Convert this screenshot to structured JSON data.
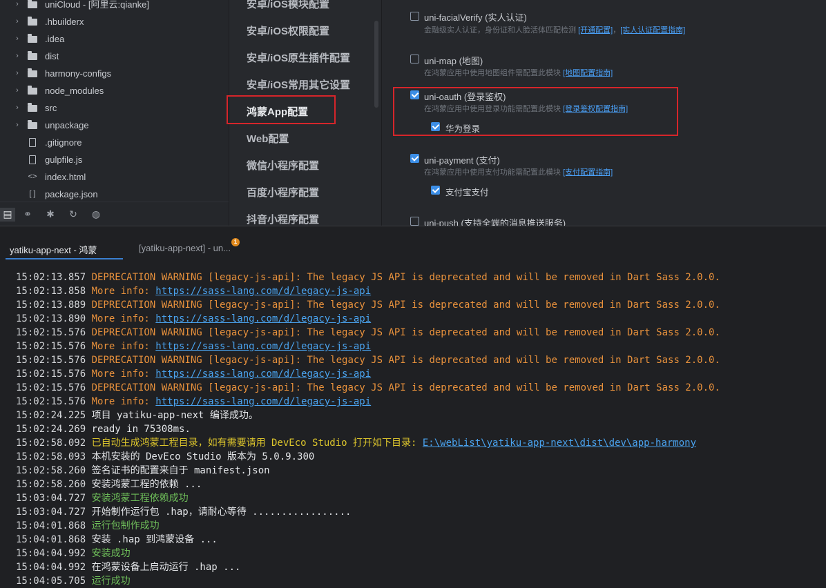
{
  "explorer": {
    "items": [
      {
        "label": "uniCloud - [阿里云:qianke]",
        "type": "folder",
        "expandable": true
      },
      {
        "label": ".hbuilderx",
        "type": "folder",
        "expandable": true
      },
      {
        "label": ".idea",
        "type": "folder",
        "expandable": true
      },
      {
        "label": "dist",
        "type": "folder",
        "expandable": true
      },
      {
        "label": "harmony-configs",
        "type": "folder",
        "expandable": true
      },
      {
        "label": "node_modules",
        "type": "folder",
        "expandable": true
      },
      {
        "label": "src",
        "type": "folder",
        "expandable": true
      },
      {
        "label": "unpackage",
        "type": "folder",
        "expandable": true
      },
      {
        "label": ".gitignore",
        "type": "file-icon",
        "expandable": false
      },
      {
        "label": "gulpfile.js",
        "type": "js-file-icon",
        "expandable": false
      },
      {
        "label": "index.html",
        "type": "html-file-icon",
        "expandable": false
      },
      {
        "label": "package.json",
        "type": "json-file-icon",
        "expandable": false
      }
    ],
    "bottom_icons": [
      "project-manager-icon",
      "binoculars-icon",
      "bug-icon",
      "git-refresh-icon",
      "globe-icon"
    ]
  },
  "settings_nav": {
    "items": [
      {
        "label": "安卓/iOS模块配置"
      },
      {
        "label": "安卓/iOS权限配置"
      },
      {
        "label": "安卓/iOS原生插件配置"
      },
      {
        "label": "安卓/iOS常用其它设置"
      },
      {
        "label": "鸿蒙App配置",
        "selected": true
      },
      {
        "label": "Web配置"
      },
      {
        "label": "微信小程序配置"
      },
      {
        "label": "百度小程序配置"
      },
      {
        "label": "抖音小程序配置"
      }
    ]
  },
  "modules": {
    "facial": {
      "checked": false,
      "title": "uni-facialVerify (实人认证)",
      "desc": "金融级实人认证，身份证和人脸活体匹配检测",
      "link1": "[开通配置]",
      "sep": "，",
      "link2": "[实人认证配置指南]"
    },
    "map": {
      "checked": false,
      "title": "uni-map (地图)",
      "desc": "在鸿蒙应用中使用地图组件需配置此模块",
      "link": "[地图配置指南]"
    },
    "oauth": {
      "checked": true,
      "title": "uni-oauth (登录鉴权)",
      "desc": "在鸿蒙应用中使用登录功能需配置此模块",
      "link": "[登录鉴权配置指南]",
      "sub": {
        "checked": true,
        "label": "华为登录"
      }
    },
    "payment": {
      "checked": true,
      "title": "uni-payment (支付)",
      "desc": "在鸿蒙应用中使用支付功能需配置此模块",
      "link": "[支付配置指南]",
      "sub": {
        "checked": true,
        "label": "支付宝支付"
      }
    },
    "push": {
      "checked": false,
      "title": "uni-push (支持全端的消息推送服务)"
    }
  },
  "console": {
    "tabs": [
      {
        "label": "yatiku-app-next - 鸿蒙",
        "active": true
      },
      {
        "label": "[yatiku-app-next] - un...",
        "active": false,
        "badge": "1"
      }
    ],
    "lines": [
      {
        "ts": "15:02:13.857",
        "style": "warn",
        "text": "DEPRECATION WARNING [legacy-js-api]: The legacy JS API is deprecated and will be removed in Dart Sass 2.0.0."
      },
      {
        "ts": "15:02:13.858",
        "style": "warn",
        "text": "More info: ",
        "link": "https://sass-lang.com/d/legacy-js-api"
      },
      {
        "ts": "15:02:13.889",
        "style": "warn",
        "text": "DEPRECATION WARNING [legacy-js-api]: The legacy JS API is deprecated and will be removed in Dart Sass 2.0.0."
      },
      {
        "ts": "15:02:13.890",
        "style": "warn",
        "text": "More info: ",
        "link": "https://sass-lang.com/d/legacy-js-api"
      },
      {
        "ts": "15:02:15.576",
        "style": "warn",
        "text": "DEPRECATION WARNING [legacy-js-api]: The legacy JS API is deprecated and will be removed in Dart Sass 2.0.0."
      },
      {
        "ts": "15:02:15.576",
        "style": "warn",
        "text": "More info: ",
        "link": "https://sass-lang.com/d/legacy-js-api"
      },
      {
        "ts": "15:02:15.576",
        "style": "warn",
        "text": "DEPRECATION WARNING [legacy-js-api]: The legacy JS API is deprecated and will be removed in Dart Sass 2.0.0."
      },
      {
        "ts": "15:02:15.576",
        "style": "warn",
        "text": "More info: ",
        "link": "https://sass-lang.com/d/legacy-js-api"
      },
      {
        "ts": "15:02:15.576",
        "style": "warn",
        "text": "DEPRECATION WARNING [legacy-js-api]: The legacy JS API is deprecated and will be removed in Dart Sass 2.0.0."
      },
      {
        "ts": "15:02:15.576",
        "style": "warn",
        "text": "More info: ",
        "link": "https://sass-lang.com/d/legacy-js-api"
      },
      {
        "ts": "15:02:24.225",
        "style": "plain",
        "text": "项目 yatiku-app-next 编译成功。"
      },
      {
        "ts": "15:02:24.269",
        "style": "plain",
        "text": "ready in 75308ms."
      },
      {
        "ts": "15:02:58.092",
        "style": "yellow",
        "text": "已自动生成鸿蒙工程目录，如有需要请用 DevEco Studio 打开如下目录: ",
        "link": "E:\\webList\\yatiku-app-next\\dist\\dev\\app-harmony"
      },
      {
        "ts": "15:02:58.093",
        "style": "plain",
        "text": "本机安装的 DevEco Studio 版本为 5.0.9.300"
      },
      {
        "ts": "15:02:58.260",
        "style": "plain",
        "text": "签名证书的配置来自于 manifest.json"
      },
      {
        "ts": "15:02:58.260",
        "style": "plain",
        "text": "安装鸿蒙工程的依赖 ..."
      },
      {
        "ts": "15:03:04.727",
        "style": "ok",
        "text": "安装鸿蒙工程依赖成功"
      },
      {
        "ts": "15:03:04.727",
        "style": "plain",
        "text": "开始制作运行包 .hap，请耐心等待 ................."
      },
      {
        "ts": "15:04:01.868",
        "style": "ok",
        "text": "运行包制作成功"
      },
      {
        "ts": "15:04:01.868",
        "style": "plain",
        "text": "安装 .hap 到鸿蒙设备 ..."
      },
      {
        "ts": "15:04:04.992",
        "style": "ok",
        "text": "安装成功"
      },
      {
        "ts": "15:04:04.992",
        "style": "plain",
        "text": "在鸿蒙设备上启动运行 .hap ..."
      },
      {
        "ts": "15:04:05.705",
        "style": "ok",
        "text": "运行成功"
      }
    ]
  }
}
